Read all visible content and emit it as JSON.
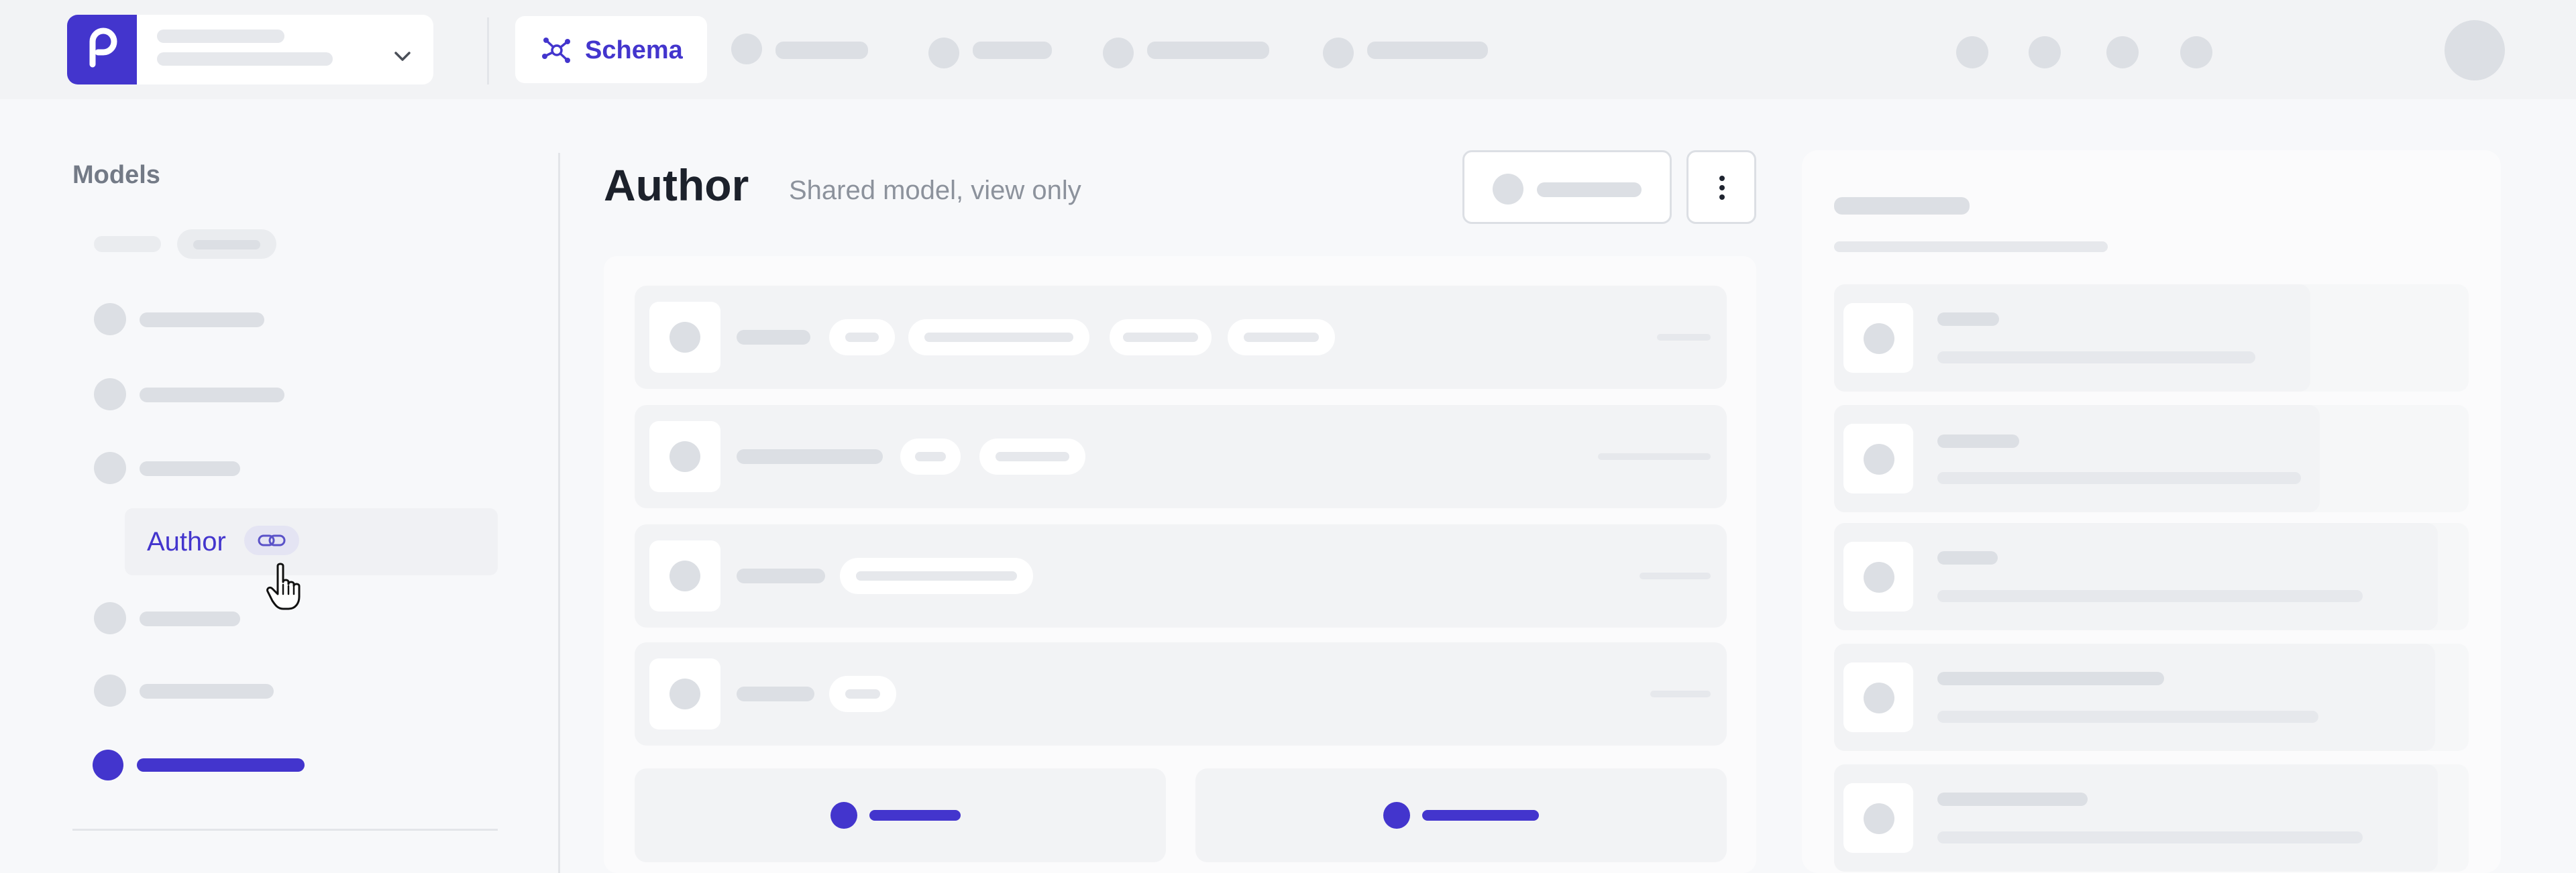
{
  "header": {
    "schema_tab_label": "Schema"
  },
  "sidebar": {
    "title": "Models",
    "active_item_label": "Author"
  },
  "main": {
    "title": "Author",
    "subtitle": "Shared model, view only"
  },
  "icons": {
    "logo": "brand-logo-icon",
    "schema": "schema-graph-icon",
    "chevron": "chevron-down-icon",
    "link": "link-icon",
    "more": "vertical-dots-icon",
    "cursor": "pointer-hand-icon"
  },
  "colors": {
    "accent": "#4335cd",
    "skeleton": "#e6e8ec",
    "background": "#f7f8fa"
  }
}
